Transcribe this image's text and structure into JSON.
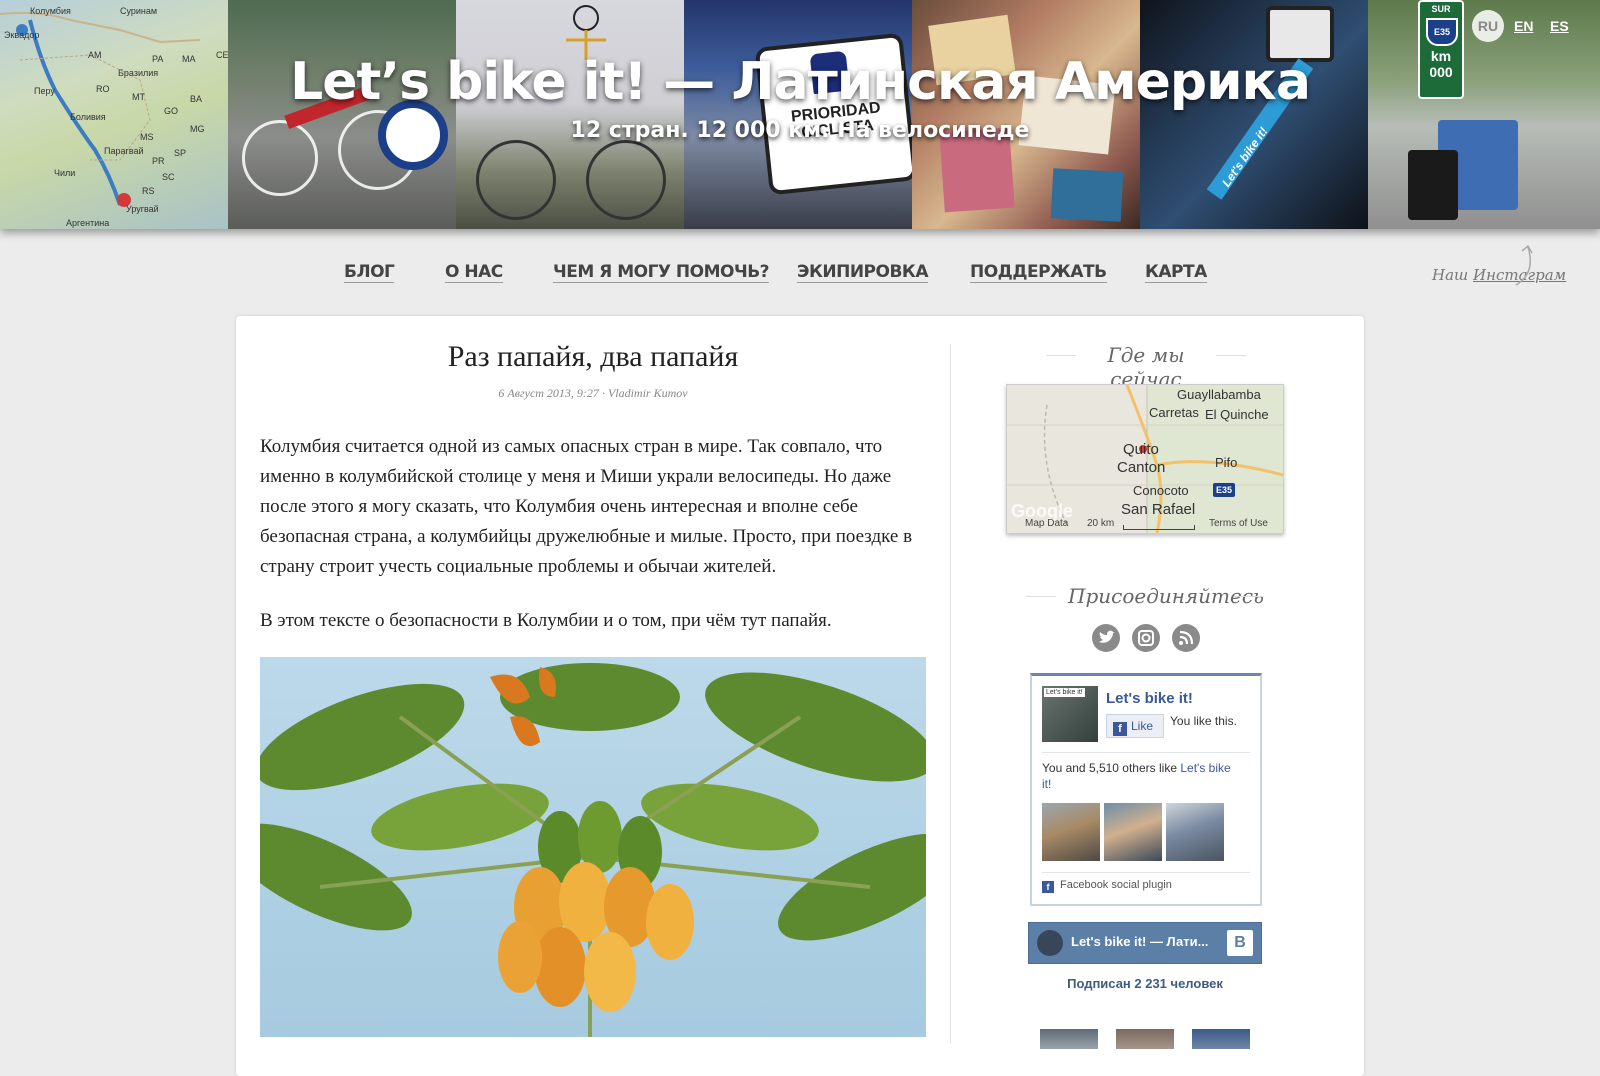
{
  "header": {
    "title": "Let’s bike it! — Латинская Америка",
    "subtitle": "12 стран. 12 000 км. На велосипеде",
    "languages": [
      {
        "code": "RU",
        "active": true
      },
      {
        "code": "EN",
        "active": false
      },
      {
        "code": "ES",
        "active": false
      }
    ],
    "map_tile_labels": [
      "Колумбия",
      "Суринам",
      "Эквадор",
      "Перу",
      "Бразилия",
      "Боливия",
      "Парагвай",
      "Чили",
      "Аргентина",
      "Уругвай",
      "AM",
      "PA",
      "MA",
      "CE",
      "RO",
      "MT",
      "BA",
      "GO",
      "MG",
      "MS",
      "SP",
      "PR",
      "RS",
      "SC"
    ],
    "sign_text": "PRIORIDAD CICLISTA",
    "highway_sign": {
      "top": "SUR",
      "route": "E35",
      "bottom": "km 000"
    },
    "bike_tile_text": "Let's bike it!"
  },
  "nav": {
    "items": [
      "БЛОГ",
      "О НАС",
      "ЧЕМ Я МОГУ ПОМОЧЬ?",
      "ЭКИПИРОВКА",
      "ПОДДЕРЖАТЬ",
      "КАРТА"
    ],
    "instagram_prefix": "Наш",
    "instagram_link": "Инстаграм"
  },
  "post": {
    "title": "Раз папайя, два папайя",
    "date": "6 Август 2013, 9:27",
    "separator": "·",
    "author": "Vladimir Kumov",
    "paragraph1": "Колумбия считается одной из самых опасных стран в мире. Так совпало, что именно в колумбийской столице у меня и Миши украли велосипеды. Но даже после этого я могу сказать, что Колумбия очень интересная и вполне себе безопасная страна, а колумбийцы дружелюбные и милые. Просто, при поездке в страну строит учесть социальные проблемы и обычаи жителей.",
    "paragraph2": "В этом тексте о безопасности в Колумбии и о том, при чём тут папайя."
  },
  "sidebar": {
    "where_heading": "Где мы сейчас",
    "map_labels": {
      "guayllabamba": "Guayllabamba",
      "carretas": "Carretas",
      "el_quinche": "El Quinche",
      "quito": "Quito",
      "canton": "Canton",
      "pifo": "Pifo",
      "conocoto": "Conocoto",
      "san_rafael": "San Rafael",
      "route_shield": "E35",
      "google": "Google",
      "map_data": "Map Data",
      "scale": "20 km",
      "terms": "Terms of Use"
    },
    "join_heading": "Присоединяйтесь",
    "social_icons": [
      "twitter-icon",
      "instagram-icon",
      "rss-icon"
    ],
    "facebook": {
      "page_name": "Let's bike it!",
      "thumb_caption": "Let's bike it!",
      "like_button": "Like",
      "you_like": "You like this.",
      "count_text": "You and 5,510 others like",
      "count_link": "Let's bike it!",
      "plugin_label": "Facebook social plugin"
    },
    "vk": {
      "title": "Let's bike it! — Лати...",
      "logo": "B",
      "subscribers": "Подписан 2 231 человек"
    }
  },
  "colors": {
    "background": "#ececec",
    "facebook_blue": "#3b5998",
    "vk_blue": "#5b7fa6"
  }
}
